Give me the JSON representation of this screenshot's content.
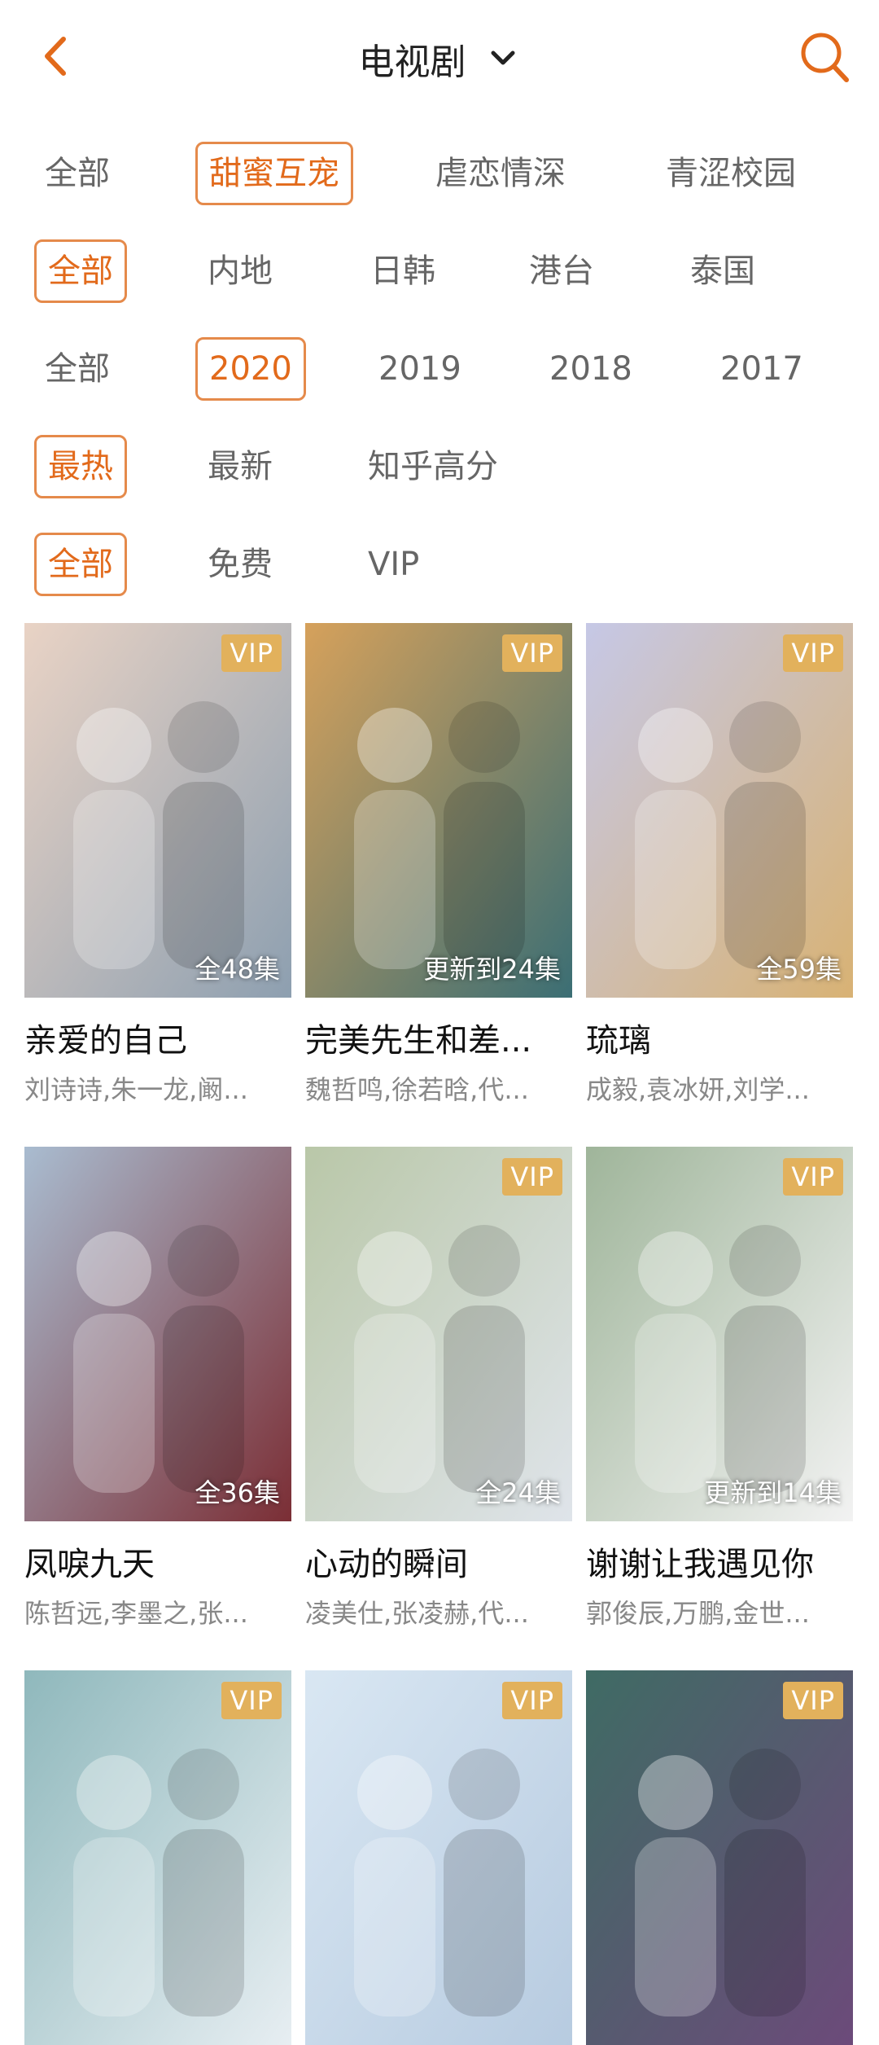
{
  "header": {
    "title": "电视剧"
  },
  "filters": {
    "theme": [
      "全部",
      "甜蜜互宠",
      "虐恋情深",
      "青涩校园"
    ],
    "theme_selected": 1,
    "region": [
      "全部",
      "内地",
      "日韩",
      "港台",
      "泰国"
    ],
    "region_selected": 0,
    "year": [
      "全部",
      "2020",
      "2019",
      "2018",
      "2017"
    ],
    "year_selected": 1,
    "sort": [
      "最热",
      "最新",
      "知乎高分"
    ],
    "sort_selected": 0,
    "pay": [
      "全部",
      "免费",
      "VIP"
    ],
    "pay_selected": 0
  },
  "items": [
    {
      "title": "亲爱的自己",
      "cast": "刘诗诗,朱一龙,阚...",
      "badge": "VIP",
      "episodes": "全48集",
      "colors": [
        "#e9d3c5",
        "#8d9fb0"
      ]
    },
    {
      "title": "完美先生和差...",
      "cast": "魏哲鸣,徐若晗,代...",
      "badge": "VIP",
      "episodes": "更新到24集",
      "colors": [
        "#d6a15b",
        "#3b6e74"
      ]
    },
    {
      "title": "琉璃",
      "cast": "成毅,袁冰妍,刘学...",
      "badge": "VIP",
      "episodes": "全59集",
      "colors": [
        "#c6c8e6",
        "#d8b274"
      ]
    },
    {
      "title": "凤唳九天",
      "cast": "陈哲远,李墨之,张...",
      "badge": "",
      "episodes": "全36集",
      "colors": [
        "#a9bcd0",
        "#7b2e35"
      ]
    },
    {
      "title": "心动的瞬间",
      "cast": "凌美仕,张凌赫,代...",
      "badge": "VIP",
      "episodes": "全24集",
      "colors": [
        "#b9c7a8",
        "#dfe4ea"
      ]
    },
    {
      "title": "谢谢让我遇见你",
      "cast": "郭俊辰,万鹏,金世...",
      "badge": "VIP",
      "episodes": "更新到14集",
      "colors": [
        "#9fb59a",
        "#f2f2f2"
      ]
    },
    {
      "title": "",
      "cast": "",
      "badge": "VIP",
      "episodes": "",
      "colors": [
        "#8fb8bc",
        "#e7eef2"
      ]
    },
    {
      "title": "",
      "cast": "",
      "badge": "VIP",
      "episodes": "",
      "colors": [
        "#d9e7f3",
        "#b7cbe0"
      ]
    },
    {
      "title": "",
      "cast": "",
      "badge": "VIP",
      "episodes": "",
      "colors": [
        "#3f6b64",
        "#6c4a7a"
      ]
    }
  ]
}
